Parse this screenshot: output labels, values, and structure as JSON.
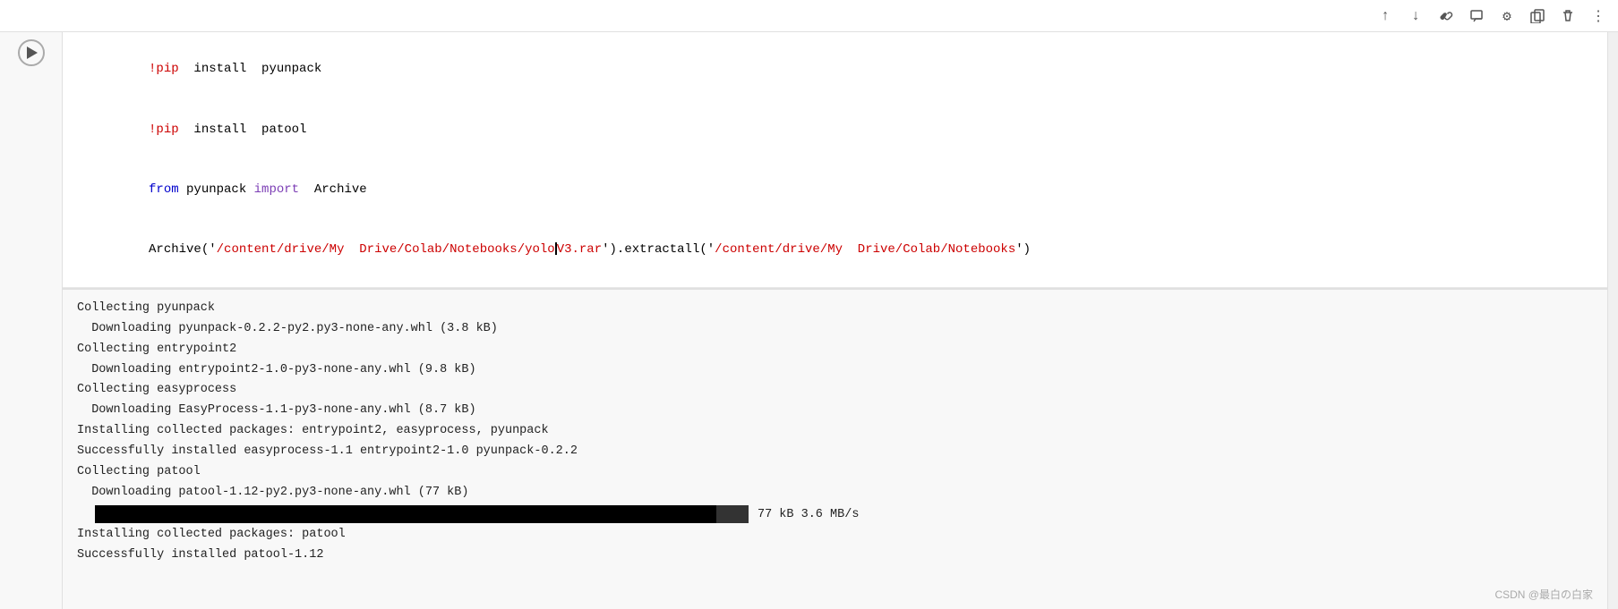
{
  "toolbar": {
    "icons": [
      {
        "name": "arrow-up-icon",
        "symbol": "↑"
      },
      {
        "name": "arrow-down-icon",
        "symbol": "↓"
      },
      {
        "name": "link-icon",
        "symbol": "🔗"
      },
      {
        "name": "comment-icon",
        "symbol": "💬"
      },
      {
        "name": "settings-icon",
        "symbol": "⚙"
      },
      {
        "name": "copy-icon",
        "symbol": "⎘"
      },
      {
        "name": "trash-icon",
        "symbol": "🗑"
      },
      {
        "name": "more-icon",
        "symbol": "⋮"
      }
    ]
  },
  "code": {
    "line1": "!pip  install  pyunpack",
    "line2": "!pip  install  patool",
    "line3_from": "from",
    "line3_mid": " pyunpack ",
    "line3_import": "import",
    "line3_end": "  Archive",
    "line4_archive": "Archive",
    "line4_open": "('",
    "line4_path1": "/content/drive/My  Drive/Colab/Notebooks/yoloV3.rar",
    "line4_close": "').",
    "line4_method": "extractall",
    "line4_open2": "('",
    "line4_path2": "/content/drive/My  Drive/Colab/Notebooks",
    "line4_end": "')"
  },
  "output": {
    "lines": [
      {
        "text": "Collecting pyunpack",
        "indent": false
      },
      {
        "text": "  Downloading pyunpack-0.2.2-py2.py3-none-any.whl (3.8 kB)",
        "indent": false
      },
      {
        "text": "Collecting entrypoint2",
        "indent": false
      },
      {
        "text": "  Downloading entrypoint2-1.0-py3-none-any.whl (9.8 kB)",
        "indent": false
      },
      {
        "text": "Collecting easyprocess",
        "indent": false
      },
      {
        "text": "  Downloading EasyProcess-1.1-py3-none-any.whl (8.7 kB)",
        "indent": false
      },
      {
        "text": "Installing collected packages: entrypoint2, easyprocess, pyunpack",
        "indent": false
      },
      {
        "text": "Successfully installed easyprocess-1.1 entrypoint2-1.0 pyunpack-0.2.2",
        "indent": false
      },
      {
        "text": "Collecting patool",
        "indent": false
      },
      {
        "text": "  Downloading patool-1.12-py2.py3-none-any.whl (77 kB)",
        "indent": false
      },
      {
        "text": "PROGRESS_BAR",
        "indent": false
      },
      {
        "text": "Installing collected packages: patool",
        "indent": false
      },
      {
        "text": "Successfully installed patool-1.12",
        "indent": false
      }
    ],
    "progress_label": "77 kB  3.6 MB/s",
    "progress_segments": 19
  },
  "watermark": {
    "text": "CSDN @最白の白家"
  }
}
